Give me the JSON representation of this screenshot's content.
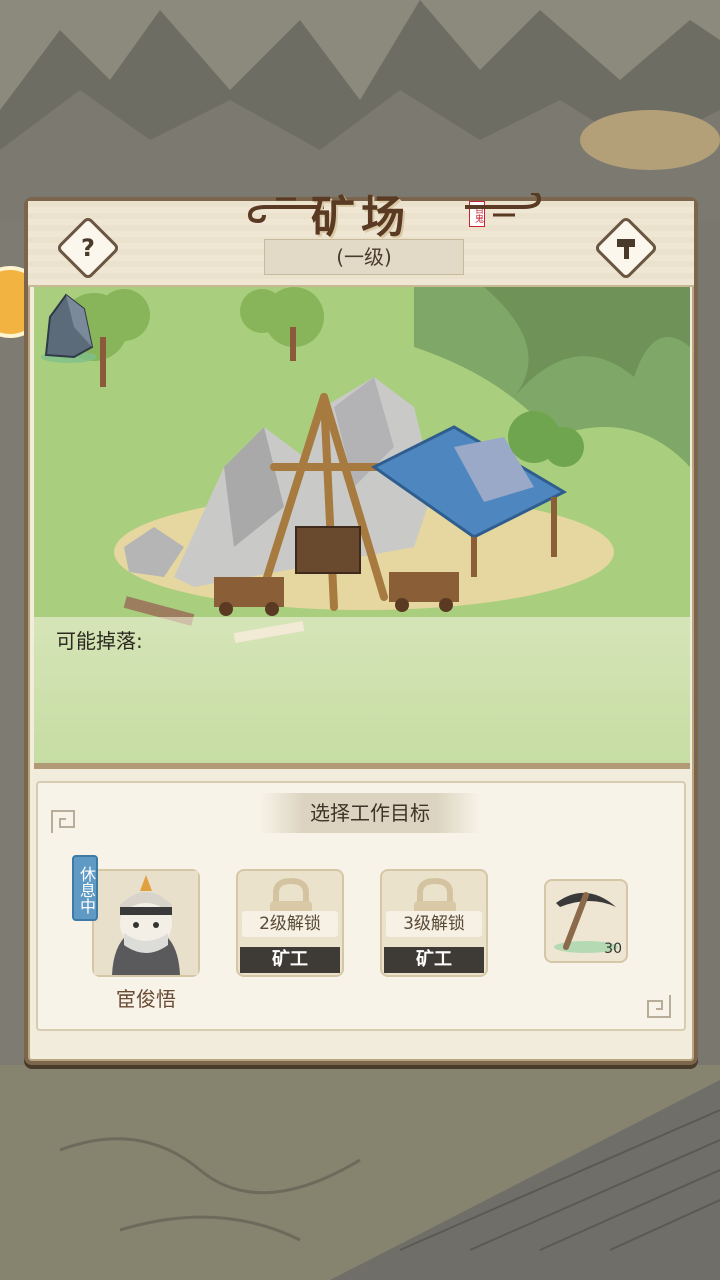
{
  "building": {
    "title": "矿场",
    "seal": "百鬼",
    "level": "(一级)"
  },
  "drops": {
    "label": "可能掉落:",
    "items": [
      {
        "icon": "ore-rock-icon"
      }
    ]
  },
  "work": {
    "section_title": "选择工作目标",
    "worker": {
      "name": "宦俊悟",
      "status": "休息中"
    },
    "slots": [
      {
        "unlock": "2级解锁",
        "role": "矿工"
      },
      {
        "unlock": "3级解锁",
        "role": "矿工"
      }
    ],
    "tool": {
      "icon": "pickaxe-icon",
      "count": "30"
    }
  },
  "colors": {
    "panel_border": "#7b654c",
    "grass": "#a9cf7e",
    "status_badge": "#5e9ac4"
  }
}
